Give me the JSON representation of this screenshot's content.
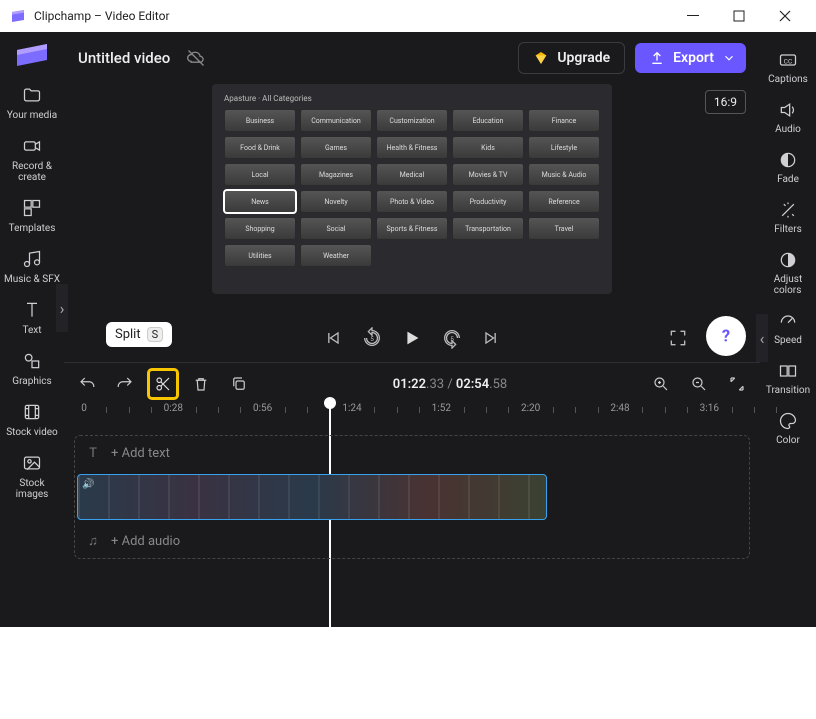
{
  "window": {
    "title": "Clipchamp – Video Editor"
  },
  "app": {
    "video_title": "Untitled video",
    "upgrade_label": "Upgrade",
    "export_label": "Export",
    "aspect": "16:9"
  },
  "left_rail": [
    {
      "label": "Your media"
    },
    {
      "label": "Record &\ncreate"
    },
    {
      "label": "Templates"
    },
    {
      "label": "Music & SFX"
    },
    {
      "label": "Text"
    },
    {
      "label": "Graphics"
    },
    {
      "label": "Stock video"
    },
    {
      "label": "Stock\nimages"
    }
  ],
  "right_rail": [
    {
      "label": "Captions"
    },
    {
      "label": "Audio"
    },
    {
      "label": "Fade"
    },
    {
      "label": "Filters"
    },
    {
      "label": "Adjust\ncolors"
    },
    {
      "label": "Speed"
    },
    {
      "label": "Transition"
    },
    {
      "label": "Color"
    }
  ],
  "preview": {
    "heading": "Apasture · All Categories",
    "tiles": [
      "Business",
      "Communication",
      "Customization",
      "Education",
      "Finance",
      "Food & Drink",
      "Games",
      "Health & Fitness",
      "Kids",
      "Lifestyle",
      "Local",
      "Magazines",
      "Medical",
      "Movies & TV",
      "Music & Audio",
      "News",
      "Novelty",
      "Photo & Video",
      "Productivity",
      "Reference",
      "Shopping",
      "Social",
      "Sports & Fitness",
      "Transportation",
      "Travel",
      "Utilities",
      "Weather"
    ],
    "selected_index": 15
  },
  "tooltip": {
    "label": "Split",
    "key": "S"
  },
  "time": {
    "current": "01:22",
    "current_frac": ".33",
    "total": "02:54",
    "total_frac": ".58"
  },
  "ruler": [
    "0",
    "0:28",
    "0:56",
    "1:24",
    "1:52",
    "2:20",
    "2:48",
    "3:16"
  ],
  "tracks": {
    "add_text": "+ Add text",
    "add_audio": "+ Add audio"
  },
  "colors": {
    "accent": "#6a57ff",
    "highlight": "#f7c600"
  }
}
